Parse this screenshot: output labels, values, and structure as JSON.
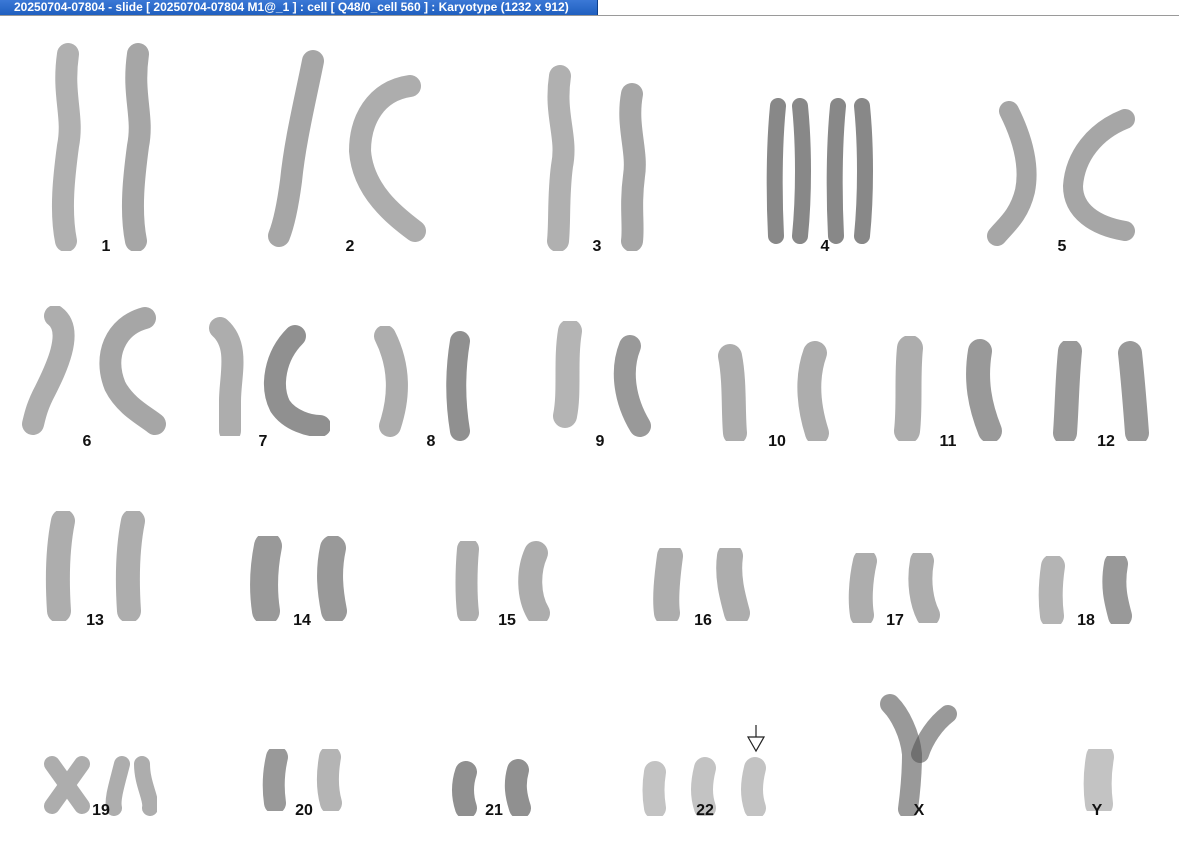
{
  "window": {
    "title": "20250704-07804 - slide [ 20250704-07804 M1@_1 ] : cell [ Q48/0_cell 560 ] : Karyotype  (1232 x 912)"
  },
  "karyotype": {
    "labels": {
      "c1": "1",
      "c2": "2",
      "c3": "3",
      "c4": "4",
      "c5": "5",
      "c6": "6",
      "c7": "7",
      "c8": "8",
      "c9": "9",
      "c10": "10",
      "c11": "11",
      "c12": "12",
      "c13": "13",
      "c14": "14",
      "c15": "15",
      "c16": "16",
      "c17": "17",
      "c18": "18",
      "c19": "19",
      "c20": "20",
      "c21": "21",
      "c22": "22",
      "cX": "X",
      "cY": "Y"
    },
    "abnormality_marker": "arrow-down-icon"
  },
  "colors": {
    "titlebar": "#2a6ad0",
    "chromosome": "#5a5a5a",
    "label": "#111111"
  }
}
